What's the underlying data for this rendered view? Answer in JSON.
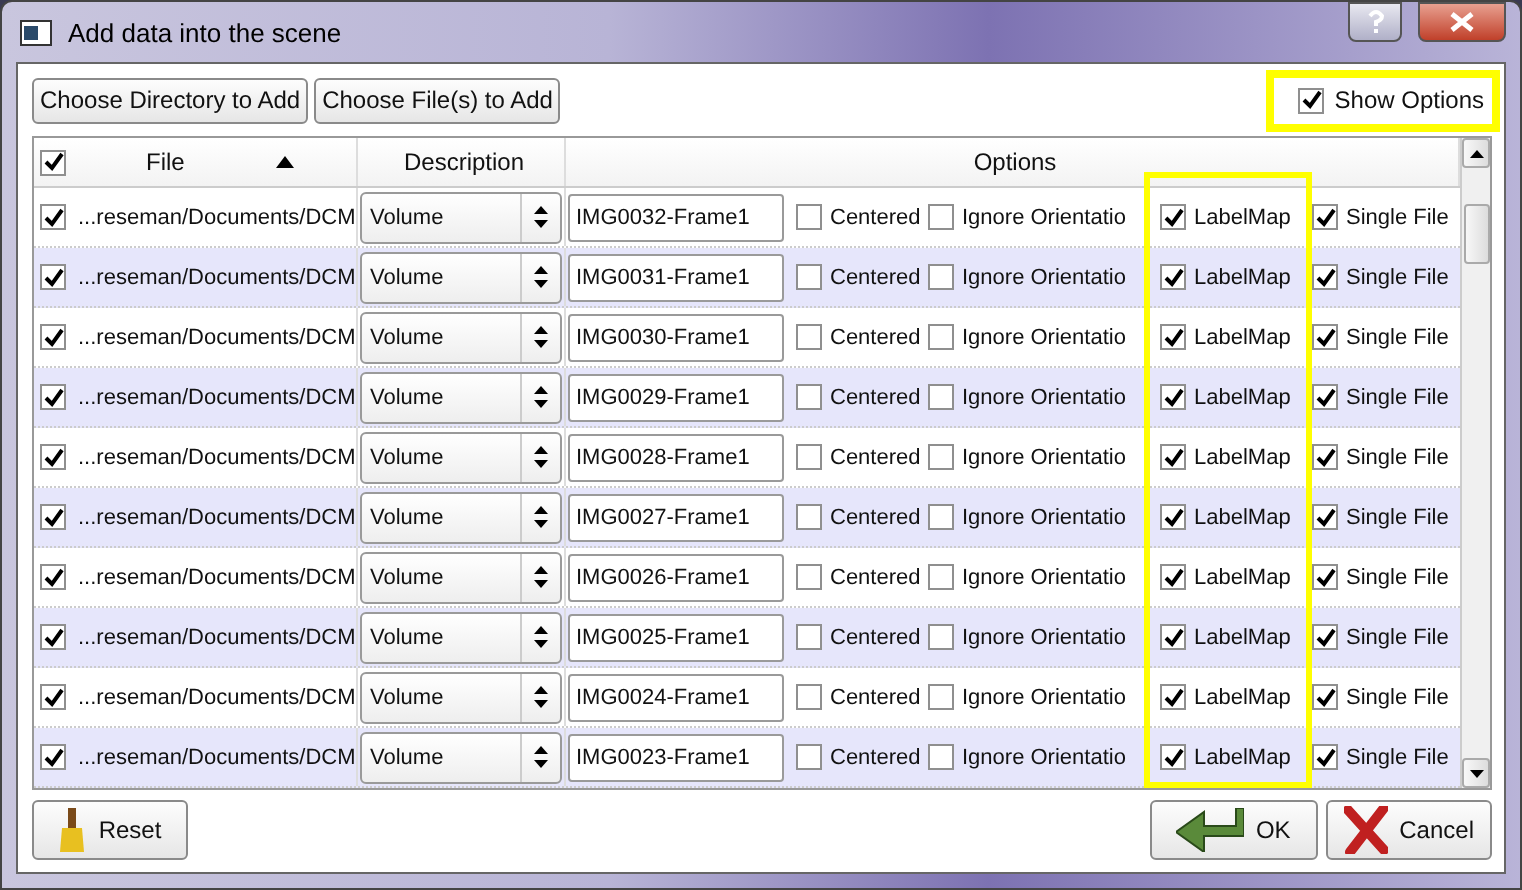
{
  "window": {
    "title": "Add data into the scene"
  },
  "toolbar": {
    "buttons": [
      "Choose Directory to Add",
      "Choose File(s) to Add"
    ],
    "show_options": {
      "label": "Show Options",
      "checked": true,
      "highlighted": true
    }
  },
  "table": {
    "header": {
      "checked": true,
      "file": "File",
      "description": "Description",
      "options": "Options"
    },
    "option_highlights": [
      false,
      false,
      true,
      false
    ],
    "rows": [
      {
        "checked": true,
        "file": "...reseman/Documents/DCM",
        "description": "Volume",
        "name": "IMG0032-Frame1",
        "options": [
          {
            "label": "Centered",
            "checked": false
          },
          {
            "label": "Ignore Orientatio",
            "checked": false
          },
          {
            "label": "LabelMap",
            "checked": true
          },
          {
            "label": "Single File",
            "checked": true
          }
        ]
      },
      {
        "checked": true,
        "file": "...reseman/Documents/DCM",
        "description": "Volume",
        "name": "IMG0031-Frame1",
        "options": [
          {
            "label": "Centered",
            "checked": false
          },
          {
            "label": "Ignore Orientatio",
            "checked": false
          },
          {
            "label": "LabelMap",
            "checked": true
          },
          {
            "label": "Single File",
            "checked": true
          }
        ]
      },
      {
        "checked": true,
        "file": "...reseman/Documents/DCM",
        "description": "Volume",
        "name": "IMG0030-Frame1",
        "options": [
          {
            "label": "Centered",
            "checked": false
          },
          {
            "label": "Ignore Orientatio",
            "checked": false
          },
          {
            "label": "LabelMap",
            "checked": true
          },
          {
            "label": "Single File",
            "checked": true
          }
        ]
      },
      {
        "checked": true,
        "file": "...reseman/Documents/DCM",
        "description": "Volume",
        "name": "IMG0029-Frame1",
        "options": [
          {
            "label": "Centered",
            "checked": false
          },
          {
            "label": "Ignore Orientatio",
            "checked": false
          },
          {
            "label": "LabelMap",
            "checked": true
          },
          {
            "label": "Single File",
            "checked": true
          }
        ]
      },
      {
        "checked": true,
        "file": "...reseman/Documents/DCM",
        "description": "Volume",
        "name": "IMG0028-Frame1",
        "options": [
          {
            "label": "Centered",
            "checked": false
          },
          {
            "label": "Ignore Orientatio",
            "checked": false
          },
          {
            "label": "LabelMap",
            "checked": true
          },
          {
            "label": "Single File",
            "checked": true
          }
        ]
      },
      {
        "checked": true,
        "file": "...reseman/Documents/DCM",
        "description": "Volume",
        "name": "IMG0027-Frame1",
        "options": [
          {
            "label": "Centered",
            "checked": false
          },
          {
            "label": "Ignore Orientatio",
            "checked": false
          },
          {
            "label": "LabelMap",
            "checked": true
          },
          {
            "label": "Single File",
            "checked": true
          }
        ]
      },
      {
        "checked": true,
        "file": "...reseman/Documents/DCM",
        "description": "Volume",
        "name": "IMG0026-Frame1",
        "options": [
          {
            "label": "Centered",
            "checked": false
          },
          {
            "label": "Ignore Orientatio",
            "checked": false
          },
          {
            "label": "LabelMap",
            "checked": true
          },
          {
            "label": "Single File",
            "checked": true
          }
        ]
      },
      {
        "checked": true,
        "file": "...reseman/Documents/DCM",
        "description": "Volume",
        "name": "IMG0025-Frame1",
        "options": [
          {
            "label": "Centered",
            "checked": false
          },
          {
            "label": "Ignore Orientatio",
            "checked": false
          },
          {
            "label": "LabelMap",
            "checked": true
          },
          {
            "label": "Single File",
            "checked": true
          }
        ]
      },
      {
        "checked": true,
        "file": "...reseman/Documents/DCM",
        "description": "Volume",
        "name": "IMG0024-Frame1",
        "options": [
          {
            "label": "Centered",
            "checked": false
          },
          {
            "label": "Ignore Orientatio",
            "checked": false
          },
          {
            "label": "LabelMap",
            "checked": true
          },
          {
            "label": "Single File",
            "checked": true
          }
        ]
      },
      {
        "checked": true,
        "file": "...reseman/Documents/DCM",
        "description": "Volume",
        "name": "IMG0023-Frame1",
        "options": [
          {
            "label": "Centered",
            "checked": false
          },
          {
            "label": "Ignore Orientatio",
            "checked": false
          },
          {
            "label": "LabelMap",
            "checked": true
          },
          {
            "label": "Single File",
            "checked": true
          }
        ]
      }
    ]
  },
  "footer": {
    "reset": "Reset",
    "ok": "OK",
    "cancel": "Cancel"
  }
}
